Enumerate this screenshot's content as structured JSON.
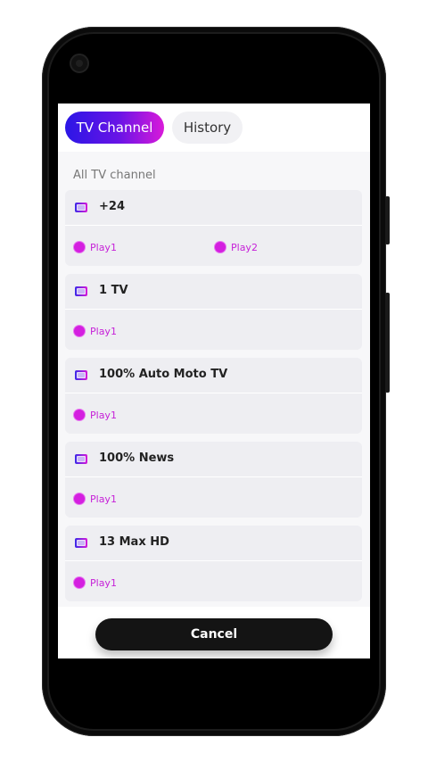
{
  "tabs": [
    {
      "label": "TV Channel",
      "active": true
    },
    {
      "label": "History",
      "active": false
    }
  ],
  "section_title": "All TV channel",
  "channels": [
    {
      "name": "+24",
      "plays": [
        "Play1",
        "Play2"
      ]
    },
    {
      "name": "1 TV",
      "plays": [
        "Play1"
      ]
    },
    {
      "name": "100% Auto Moto TV",
      "plays": [
        "Play1"
      ]
    },
    {
      "name": "100% News",
      "plays": [
        "Play1"
      ]
    },
    {
      "name": "13 Max HD",
      "plays": [
        "Play1"
      ]
    }
  ],
  "cancel_label": "Cancel",
  "colors": {
    "accent_gradient_start": "#2b16e6",
    "accent_gradient_end": "#d91ad9",
    "play_color": "#d41fe0",
    "card_bg": "#eeeef2",
    "cancel_bg": "#141414"
  },
  "icons": {
    "channel_icon": "tv-icon",
    "play_icon": "play-dot-icon"
  }
}
